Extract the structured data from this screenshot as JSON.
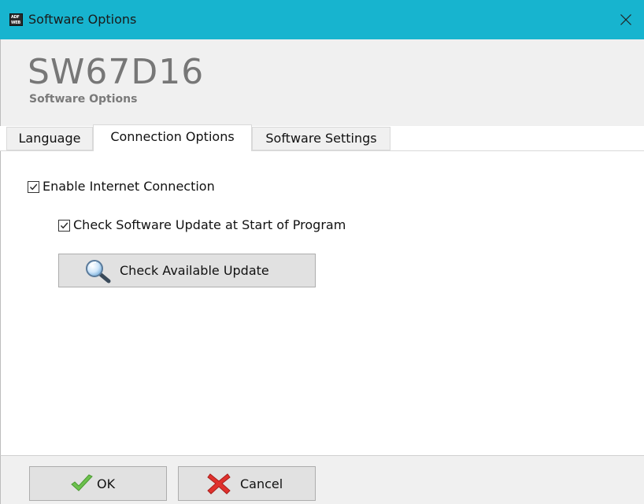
{
  "window": {
    "title": "Software Options",
    "app_icon_text_top": "ADF",
    "app_icon_text_bottom": "WEB"
  },
  "header": {
    "app_name": "SW67D16",
    "subtitle": "Software Options"
  },
  "tabs": [
    {
      "label": "Language",
      "active": false
    },
    {
      "label": "Connection Options",
      "active": true
    },
    {
      "label": "Software Settings",
      "active": false
    }
  ],
  "connection": {
    "enable_internet_label": "Enable Internet Connection",
    "enable_internet_checked": true,
    "check_update_label": "Check Software Update at Start of Program",
    "check_update_checked": true,
    "check_available_update_label": "Check Available Update"
  },
  "footer": {
    "ok_label": "OK",
    "cancel_label": "Cancel"
  },
  "colors": {
    "titlebar": "#17b4cf",
    "ok_check": "#6cc14d",
    "cancel_x": "#e0312d"
  },
  "icons": {
    "close": "close-icon",
    "magnifier": "magnifier-icon",
    "ok": "green-check-icon",
    "cancel": "red-x-icon"
  }
}
